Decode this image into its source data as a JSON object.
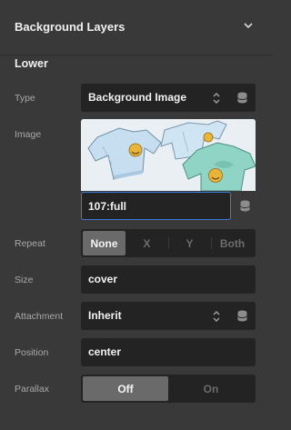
{
  "panel": {
    "title": "Background Layers",
    "section": "Lower"
  },
  "fields": {
    "type": {
      "label": "Type",
      "value": "Background Image"
    },
    "image": {
      "label": "Image",
      "value": "107:full"
    },
    "repeat": {
      "label": "Repeat",
      "options": [
        "None",
        "X",
        "Y",
        "Both"
      ],
      "selected": "None"
    },
    "size": {
      "label": "Size",
      "value": "cover"
    },
    "attachment": {
      "label": "Attachment",
      "value": "Inherit"
    },
    "position": {
      "label": "Position",
      "value": "center"
    },
    "parallax": {
      "label": "Parallax",
      "options": [
        "Off",
        "On"
      ],
      "selected": "Off"
    }
  },
  "icons": {
    "collapse": "chevron-down-icon",
    "select": "updown-arrows-icon",
    "dynamic": "database-icon"
  },
  "colors": {
    "panel_bg": "#393939",
    "field_bg": "#232323",
    "focus_border": "#3e7bd6",
    "active_segment": "#6a6a6a"
  }
}
